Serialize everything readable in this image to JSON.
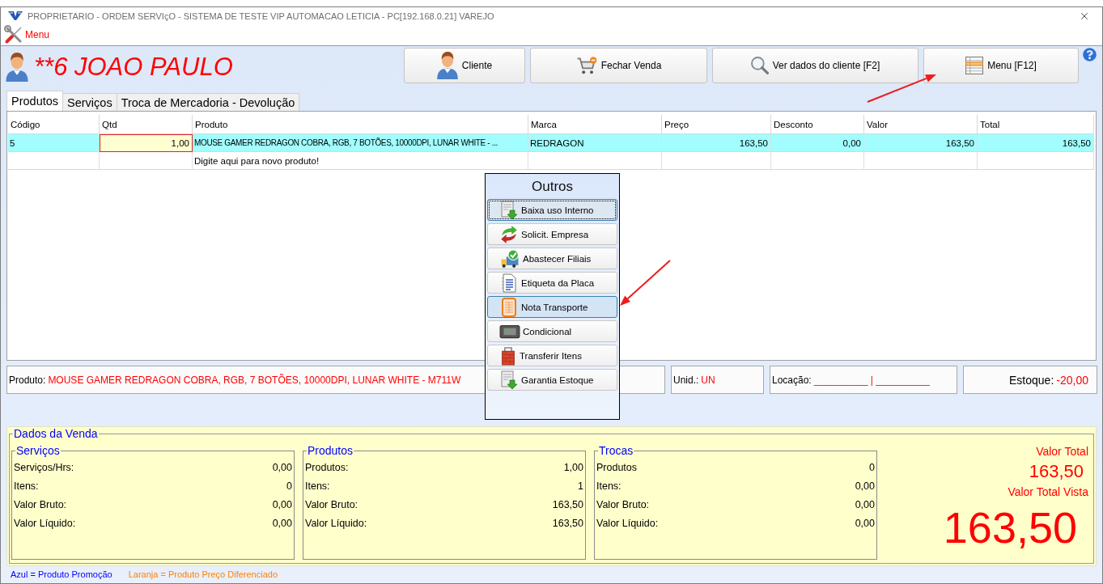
{
  "window": {
    "title": "PROPRIETARIO - ORDEM SERVIçO - SISTEMA DE TESTE VIP AUTOMACAO LETICIA - PC[192.168.0.21] VAREJO"
  },
  "menu": {
    "label": "Menu"
  },
  "customer": {
    "name": "**6 JOAO PAULO"
  },
  "toolbar": {
    "buttons": [
      {
        "label": "Cliente"
      },
      {
        "label": "Fechar Venda"
      },
      {
        "label": "Ver dados do cliente [F2]"
      },
      {
        "label": "Menu [F12]"
      }
    ]
  },
  "tabs": [
    {
      "label": "Produtos",
      "selected": true
    },
    {
      "label": "Serviços",
      "selected": false
    },
    {
      "label": "Troca de Mercadoria - Devolução",
      "selected": false
    }
  ],
  "table": {
    "columns": [
      {
        "label": "Código",
        "kind": "text"
      },
      {
        "label": "Qtd",
        "kind": "number"
      },
      {
        "label": "Produto",
        "kind": "text"
      },
      {
        "label": "Marca",
        "kind": "text"
      },
      {
        "label": "Preço",
        "kind": "number"
      },
      {
        "label": "Desconto",
        "kind": "number"
      },
      {
        "label": "Valor",
        "kind": "number"
      },
      {
        "label": "Total",
        "kind": "number"
      }
    ],
    "rows": [
      {
        "selected": true,
        "cells": [
          {
            "text": "5",
            "editing": false
          },
          {
            "text": "1,00",
            "editing": true
          },
          {
            "text": "MOUSE GAMER REDRAGON COBRA, RGB, 7 BOTÕES, 10000DPI, LUNAR WHITE - ...",
            "editing": false
          },
          {
            "text": "REDRAGON",
            "editing": false
          },
          {
            "text": "163,50",
            "editing": false
          },
          {
            "text": "0,00",
            "editing": false
          },
          {
            "text": "163,50",
            "editing": false
          },
          {
            "text": "163,50",
            "editing": false
          }
        ]
      }
    ],
    "new_row": {
      "placeholder": "Digite aqui para novo produto!"
    }
  },
  "product_info": {
    "product": {
      "label": "Produto:",
      "value": "MOUSE GAMER REDRAGON COBRA, RGB, 7 BOTÕES, 10000DPI, LUNAR WHITE - M711W"
    },
    "unit": {
      "label": "Unid.:",
      "value": "UN"
    },
    "location": {
      "label": "Locação:",
      "value": "__________ | __________"
    },
    "stock": {
      "label": "Estoque:",
      "value": "-20,00"
    }
  },
  "popup": {
    "title": "Outros",
    "items": [
      {
        "label": "Baixa uso Interno",
        "focused": true,
        "hovered": false
      },
      {
        "label": "Solicit. Empresa",
        "focused": false,
        "hovered": false
      },
      {
        "label": "Abastecer Filiais",
        "focused": false,
        "hovered": false
      },
      {
        "label": "Etiqueta da Placa",
        "focused": false,
        "hovered": false
      },
      {
        "label": "Nota Transporte",
        "focused": false,
        "hovered": true
      },
      {
        "label": "Condicional",
        "focused": false,
        "hovered": false
      },
      {
        "label": "Transferir Itens",
        "focused": false,
        "hovered": false
      },
      {
        "label": "Garantia Estoque",
        "focused": false,
        "hovered": false
      }
    ]
  },
  "sale_data": {
    "title": "Dados da Venda",
    "groups": [
      {
        "title": "Serviços",
        "rows": [
          {
            "label": "Serviços/Hrs:",
            "value": "0,00"
          },
          {
            "label": "Itens:",
            "value": "0"
          },
          {
            "label": "Valor Bruto:",
            "value": "0,00"
          },
          {
            "label": "Valor Líquido:",
            "value": "0,00"
          }
        ]
      },
      {
        "title": "Produtos",
        "rows": [
          {
            "label": "Produtos:",
            "value": "1,00"
          },
          {
            "label": "Itens:",
            "value": "1"
          },
          {
            "label": "Valor Bruto:",
            "value": "163,50"
          },
          {
            "label": "Valor Líquido:",
            "value": "163,50"
          }
        ]
      },
      {
        "title": "Trocas",
        "rows": [
          {
            "label": "Produtos",
            "value": "0"
          },
          {
            "label": "Itens:",
            "value": "0,00"
          },
          {
            "label": "Valor Bruto:",
            "value": "0,00"
          },
          {
            "label": "Valor Líquido:",
            "value": "0,00"
          }
        ]
      }
    ],
    "totals": {
      "total_label": "Valor Total",
      "total_value": "163,50",
      "cash_label": "Valor Total Vista",
      "cash_value": "163,50"
    }
  },
  "legend": [
    {
      "text": "Azul = Produto Promoção",
      "color": "#0000ff"
    },
    {
      "text": "Laranja = Produto Preço Diferenciado",
      "color": "#ff8000"
    }
  ]
}
